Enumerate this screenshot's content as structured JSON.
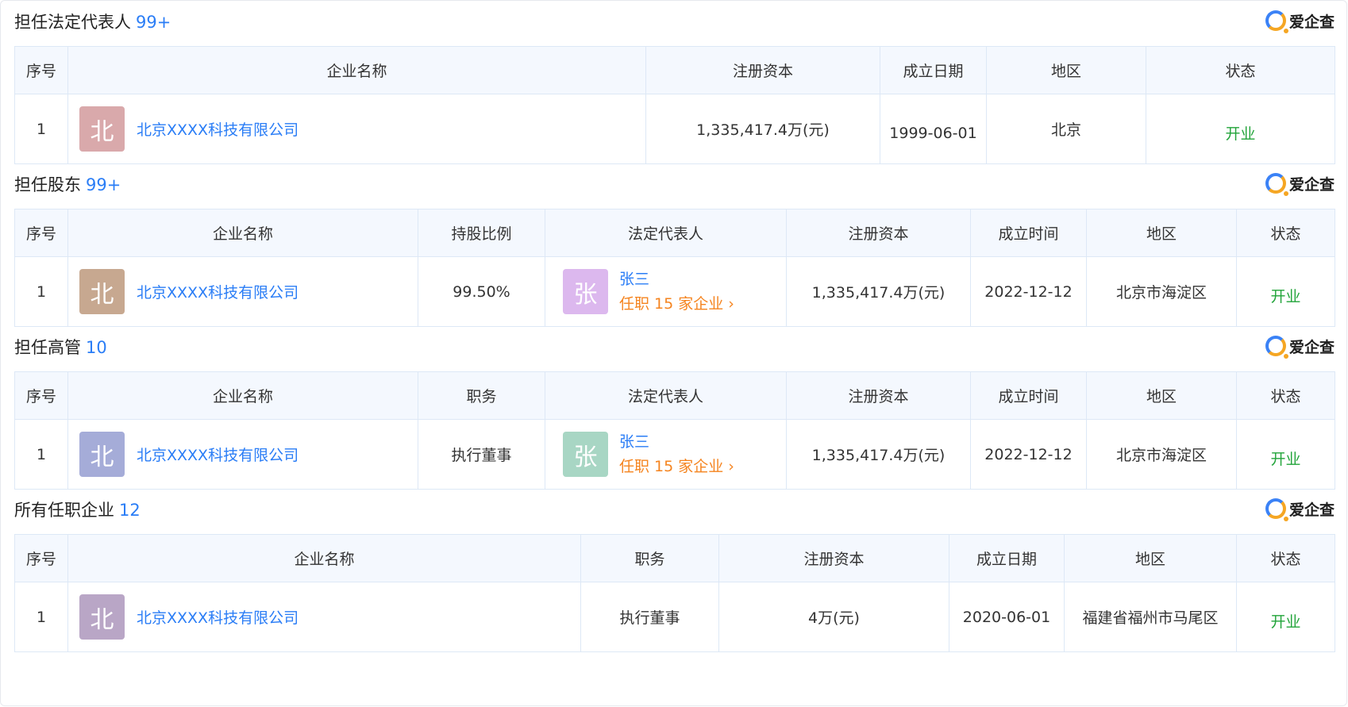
{
  "brand": {
    "name": "爱企查"
  },
  "colors": {
    "accent": "#2a7df6",
    "status_open": "#22a43a",
    "job_link": "#f5841f"
  },
  "sections": [
    {
      "title": "担任法定代表人",
      "count": "99+",
      "headers": [
        "序号",
        "企业名称",
        "注册资本",
        "成立日期",
        "地区",
        "状态"
      ],
      "rows": [
        {
          "index": "1",
          "avatar_char": "北",
          "avatar_color": "#d9a9ab",
          "company": "北京XXXX科技有限公司",
          "capital": "1,335,417.4万(元)",
          "date": "1999-06-01",
          "region": "北京",
          "status": "开业"
        }
      ]
    },
    {
      "title": "担任股东",
      "count": "99+",
      "headers": [
        "序号",
        "企业名称",
        "持股比例",
        "法定代表人",
        "注册资本",
        "成立时间",
        "地区",
        "状态"
      ],
      "rows": [
        {
          "index": "1",
          "avatar_char": "北",
          "avatar_color": "#c7a890",
          "company": "北京XXXX科技有限公司",
          "ratio": "99.50%",
          "rep_avatar_char": "张",
          "rep_avatar_color": "#dcb8ee",
          "rep_name": "张三",
          "rep_jobs": "任职 15 家企业 ›",
          "capital": "1,335,417.4万(元)",
          "date": "2022-12-12",
          "region": "北京市海淀区",
          "status": "开业"
        }
      ]
    },
    {
      "title": "担任高管",
      "count": "10",
      "headers": [
        "序号",
        "企业名称",
        "职务",
        "法定代表人",
        "注册资本",
        "成立时间",
        "地区",
        "状态"
      ],
      "rows": [
        {
          "index": "1",
          "avatar_char": "北",
          "avatar_color": "#a5acd8",
          "company": "北京XXXX科技有限公司",
          "position": "执行董事",
          "rep_avatar_char": "张",
          "rep_avatar_color": "#a8d6c4",
          "rep_name": "张三",
          "rep_jobs": "任职 15 家企业 ›",
          "capital": "1,335,417.4万(元)",
          "date": "2022-12-12",
          "region": "北京市海淀区",
          "status": "开业"
        }
      ]
    },
    {
      "title": "所有任职企业",
      "count": "12",
      "headers": [
        "序号",
        "企业名称",
        "职务",
        "注册资本",
        "成立日期",
        "地区",
        "状态"
      ],
      "rows": [
        {
          "index": "1",
          "avatar_char": "北",
          "avatar_color": "#b9a6c6",
          "company": "北京XXXX科技有限公司",
          "position": "执行董事",
          "capital": "4万(元)",
          "date": "2020-06-01",
          "region": "福建省福州市马尾区",
          "status": "开业"
        }
      ]
    }
  ]
}
